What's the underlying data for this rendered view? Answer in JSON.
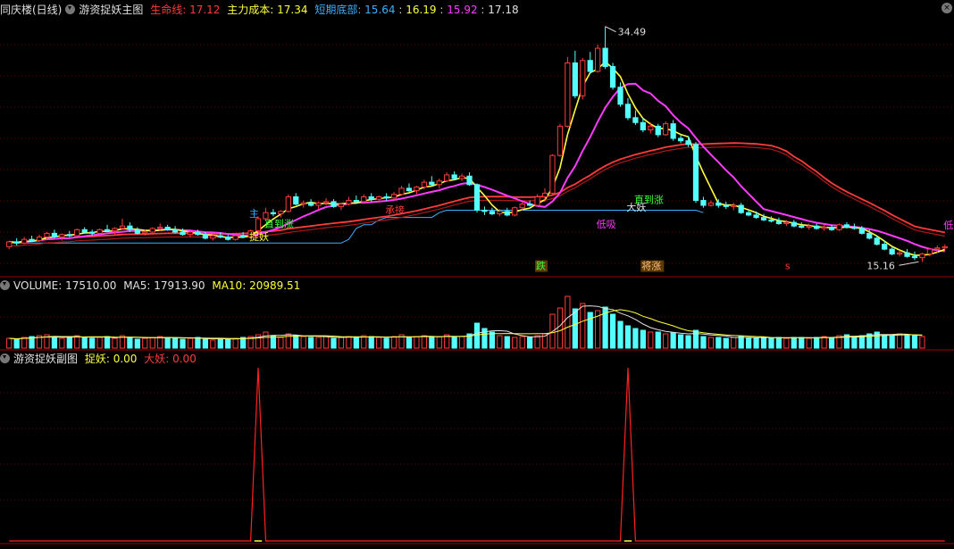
{
  "header": {
    "stock": "同庆楼(日线)",
    "indicator": "游资捉妖主图",
    "shengmingxian_label": "生命线: ",
    "shengmingxian_value": "17.12",
    "zhulichengben_label": "主力成本: ",
    "zhulichengben_value": "17.34",
    "duanqi_label": "短期底部: ",
    "duanqi_v1": "15.64",
    "duanqi_v2": "16.19",
    "duanqi_v3": "15.92",
    "duanqi_v4": "17.18"
  },
  "volume_header": {
    "label": "VOLUME: ",
    "value": "17510.00",
    "ma5_label": "MA5: ",
    "ma5_value": "17913.90",
    "ma10_label": "MA10: ",
    "ma10_value": "20989.51"
  },
  "sub_header": {
    "title": "游资捉妖副图",
    "tiyao_label": "捉妖: ",
    "tiyao_value": "0.00",
    "dayao_label": "大妖: ",
    "dayao_value": "0.00"
  },
  "colors": {
    "up": "#ff3b3b",
    "down": "#54ffff",
    "shengming": "#ff3b3b",
    "zhuli": "#ff3bff",
    "short": "#ffff3b",
    "support": "#3bafff",
    "grid": "#6a0000",
    "sub_line": "#ff2020"
  },
  "chart_data": {
    "type": "candlestick",
    "price_range": [
      15.16,
      34.49
    ],
    "high_label": "34.49",
    "low_label": "15.16",
    "candles": [
      [
        16.4,
        16.9,
        16.2,
        16.8
      ],
      [
        16.8,
        17.1,
        16.5,
        16.7
      ],
      [
        16.7,
        17.2,
        16.6,
        17.0
      ],
      [
        17.0,
        17.3,
        16.8,
        16.9
      ],
      [
        16.9,
        17.4,
        16.8,
        17.2
      ],
      [
        17.2,
        17.6,
        17.0,
        17.5
      ],
      [
        17.5,
        17.8,
        17.1,
        17.2
      ],
      [
        17.2,
        17.5,
        16.9,
        17.4
      ],
      [
        17.4,
        17.7,
        17.2,
        17.3
      ],
      [
        17.3,
        17.9,
        17.2,
        17.8
      ],
      [
        17.8,
        18.0,
        17.5,
        17.6
      ],
      [
        17.6,
        17.8,
        17.3,
        17.5
      ],
      [
        17.5,
        17.9,
        17.4,
        17.8
      ],
      [
        17.8,
        18.2,
        17.6,
        17.7
      ],
      [
        17.7,
        18.0,
        17.4,
        17.9
      ],
      [
        17.9,
        18.7,
        17.8,
        18.1
      ],
      [
        18.1,
        18.4,
        17.6,
        17.8
      ],
      [
        17.8,
        18.0,
        17.4,
        17.5
      ],
      [
        17.5,
        17.8,
        17.3,
        17.6
      ],
      [
        17.6,
        18.0,
        17.5,
        17.9
      ],
      [
        17.9,
        18.3,
        17.7,
        18.0
      ],
      [
        18.0,
        18.2,
        17.7,
        17.8
      ],
      [
        17.8,
        18.1,
        17.5,
        17.6
      ],
      [
        17.6,
        17.9,
        17.3,
        17.4
      ],
      [
        17.4,
        17.7,
        17.2,
        17.6
      ],
      [
        17.6,
        17.8,
        17.3,
        17.4
      ],
      [
        17.4,
        17.6,
        17.0,
        17.1
      ],
      [
        17.1,
        17.5,
        16.9,
        17.3
      ],
      [
        17.3,
        17.6,
        17.1,
        17.2
      ],
      [
        17.2,
        17.4,
        16.9,
        17.0
      ],
      [
        17.0,
        17.4,
        16.9,
        17.3
      ],
      [
        17.3,
        17.6,
        17.1,
        17.2
      ],
      [
        17.2,
        17.8,
        17.1,
        17.7
      ],
      [
        17.7,
        18.9,
        17.6,
        18.7
      ],
      [
        18.7,
        19.6,
        18.5,
        19.2
      ],
      [
        19.2,
        19.5,
        18.9,
        19.1
      ],
      [
        19.1,
        19.4,
        18.8,
        19.3
      ],
      [
        19.3,
        20.7,
        19.2,
        20.5
      ],
      [
        20.5,
        20.8,
        19.8,
        19.9
      ],
      [
        19.9,
        20.2,
        19.6,
        20.0
      ],
      [
        20.0,
        20.3,
        19.7,
        19.8
      ],
      [
        19.8,
        20.1,
        19.5,
        20.0
      ],
      [
        20.0,
        20.4,
        19.8,
        20.1
      ],
      [
        20.1,
        20.3,
        19.6,
        19.7
      ],
      [
        19.7,
        20.0,
        19.4,
        19.9
      ],
      [
        19.9,
        20.5,
        19.8,
        20.2
      ],
      [
        20.2,
        20.6,
        20.0,
        20.1
      ],
      [
        20.1,
        20.7,
        20.0,
        20.5
      ],
      [
        20.5,
        20.8,
        20.1,
        20.3
      ],
      [
        20.3,
        20.6,
        20.0,
        20.5
      ],
      [
        20.5,
        20.8,
        20.2,
        20.4
      ],
      [
        20.4,
        20.9,
        20.2,
        20.7
      ],
      [
        20.7,
        21.4,
        20.6,
        21.2
      ],
      [
        21.2,
        21.6,
        20.9,
        21.0
      ],
      [
        21.0,
        21.4,
        20.7,
        21.3
      ],
      [
        21.3,
        21.9,
        21.1,
        21.7
      ],
      [
        21.7,
        22.2,
        21.4,
        21.5
      ],
      [
        21.5,
        22.0,
        21.2,
        21.8
      ],
      [
        21.8,
        22.5,
        21.7,
        22.3
      ],
      [
        22.3,
        22.6,
        21.9,
        22.0
      ],
      [
        22.0,
        22.4,
        21.8,
        22.2
      ],
      [
        22.2,
        22.5,
        21.4,
        21.5
      ],
      [
        21.5,
        21.6,
        19.2,
        19.4
      ],
      [
        19.4,
        19.7,
        19.0,
        19.3
      ],
      [
        19.3,
        19.6,
        19.0,
        19.1
      ],
      [
        19.1,
        19.5,
        18.9,
        19.3
      ],
      [
        19.3,
        19.6,
        18.9,
        19.0
      ],
      [
        19.0,
        19.7,
        18.9,
        19.6
      ],
      [
        19.6,
        20.1,
        19.4,
        19.9
      ],
      [
        19.9,
        20.2,
        19.7,
        19.8
      ],
      [
        19.8,
        20.7,
        19.7,
        20.5
      ],
      [
        20.5,
        21.2,
        20.1,
        20.8
      ],
      [
        20.8,
        24.0,
        20.7,
        23.9
      ],
      [
        23.9,
        26.5,
        23.8,
        26.3
      ],
      [
        26.3,
        32.0,
        26.2,
        31.5
      ],
      [
        31.5,
        32.5,
        28.6,
        28.8
      ],
      [
        28.8,
        31.9,
        28.5,
        31.7
      ],
      [
        31.7,
        32.4,
        30.6,
        30.8
      ],
      [
        30.8,
        33.0,
        30.7,
        32.7
      ],
      [
        32.7,
        34.49,
        31.0,
        31.2
      ],
      [
        31.2,
        31.5,
        29.3,
        29.5
      ],
      [
        29.5,
        29.9,
        27.9,
        28.1
      ],
      [
        28.1,
        28.6,
        26.8,
        27.0
      ],
      [
        27.0,
        27.6,
        26.4,
        26.6
      ],
      [
        26.6,
        27.0,
        25.8,
        26.0
      ],
      [
        26.0,
        26.6,
        25.7,
        26.3
      ],
      [
        26.3,
        26.5,
        25.4,
        25.6
      ],
      [
        25.6,
        26.7,
        25.5,
        26.5
      ],
      [
        26.5,
        26.8,
        25.1,
        25.3
      ],
      [
        25.3,
        25.6,
        24.9,
        25.1
      ],
      [
        25.1,
        25.5,
        24.6,
        24.8
      ],
      [
        24.8,
        25.0,
        20.0,
        20.2
      ],
      [
        20.2,
        20.5,
        19.6,
        19.8
      ],
      [
        19.8,
        20.2,
        19.7,
        20.0
      ],
      [
        20.0,
        20.3,
        19.6,
        19.8
      ],
      [
        19.8,
        20.1,
        19.5,
        19.7
      ],
      [
        19.7,
        20.0,
        19.4,
        19.8
      ],
      [
        19.8,
        20.0,
        19.1,
        19.2
      ],
      [
        19.2,
        19.4,
        18.9,
        19.0
      ],
      [
        19.0,
        19.3,
        18.7,
        18.8
      ],
      [
        18.8,
        19.1,
        18.5,
        18.6
      ],
      [
        18.6,
        18.9,
        18.4,
        18.5
      ],
      [
        18.5,
        18.8,
        18.2,
        18.3
      ],
      [
        18.3,
        18.6,
        18.1,
        18.4
      ],
      [
        18.4,
        18.6,
        18.0,
        18.1
      ],
      [
        18.1,
        18.4,
        17.9,
        18.0
      ],
      [
        18.0,
        18.3,
        17.8,
        18.1
      ],
      [
        18.1,
        18.3,
        17.8,
        17.9
      ],
      [
        17.9,
        18.2,
        17.7,
        18.0
      ],
      [
        18.0,
        18.2,
        17.7,
        17.8
      ],
      [
        17.8,
        18.3,
        17.7,
        18.2
      ],
      [
        18.2,
        18.4,
        17.9,
        18.0
      ],
      [
        18.0,
        18.3,
        17.8,
        17.9
      ],
      [
        17.9,
        18.1,
        17.4,
        17.5
      ],
      [
        17.5,
        17.8,
        17.0,
        17.1
      ],
      [
        17.1,
        17.3,
        16.5,
        16.6
      ],
      [
        16.6,
        16.9,
        16.1,
        16.2
      ],
      [
        16.2,
        16.4,
        15.7,
        15.8
      ],
      [
        15.8,
        16.1,
        15.6,
        15.9
      ],
      [
        15.9,
        16.2,
        15.5,
        15.6
      ],
      [
        15.6,
        16.0,
        15.3,
        15.5
      ],
      [
        15.5,
        15.9,
        15.16,
        15.8
      ],
      [
        15.8,
        16.3,
        15.6,
        16.2
      ],
      [
        16.2,
        16.5,
        15.9,
        16.3
      ],
      [
        16.3,
        16.6,
        16.0,
        16.4
      ]
    ],
    "volume": [
      11,
      10,
      12,
      13,
      14,
      15,
      12,
      11,
      13,
      14,
      12,
      11,
      12,
      13,
      11,
      14,
      12,
      10,
      11,
      12,
      13,
      12,
      11,
      10,
      11,
      12,
      10,
      9,
      11,
      10,
      11,
      12,
      13,
      15,
      18,
      14,
      12,
      16,
      14,
      13,
      12,
      12,
      13,
      11,
      12,
      13,
      12,
      14,
      13,
      12,
      11,
      13,
      15,
      12,
      13,
      14,
      12,
      13,
      15,
      12,
      13,
      16,
      28,
      22,
      18,
      14,
      13,
      12,
      13,
      12,
      14,
      16,
      38,
      45,
      58,
      44,
      50,
      40,
      42,
      46,
      38,
      30,
      25,
      22,
      20,
      18,
      18,
      16,
      17,
      15,
      14,
      20,
      13,
      12,
      12,
      11,
      12,
      13,
      12,
      11,
      12,
      11,
      12,
      11,
      12,
      12,
      11,
      12,
      13,
      12,
      14,
      15,
      13,
      14,
      16,
      18,
      15,
      14,
      16,
      15,
      14,
      13
    ],
    "sub_peaks": [
      33,
      82
    ],
    "annotations": {
      "di_xi_1": "低吸",
      "di_xi_2": "低吸",
      "zhi_dao_zhang_1": "直到涨",
      "zhi_dao_zhang_2": "直到涨",
      "zhuo_yao": "捉妖",
      "da_yao": "大妖",
      "tiao": "当",
      "die": "跌",
      "zhang": "将涨",
      "s": "s",
      "zhu_1": "主",
      "zhu_2": "承接"
    }
  }
}
